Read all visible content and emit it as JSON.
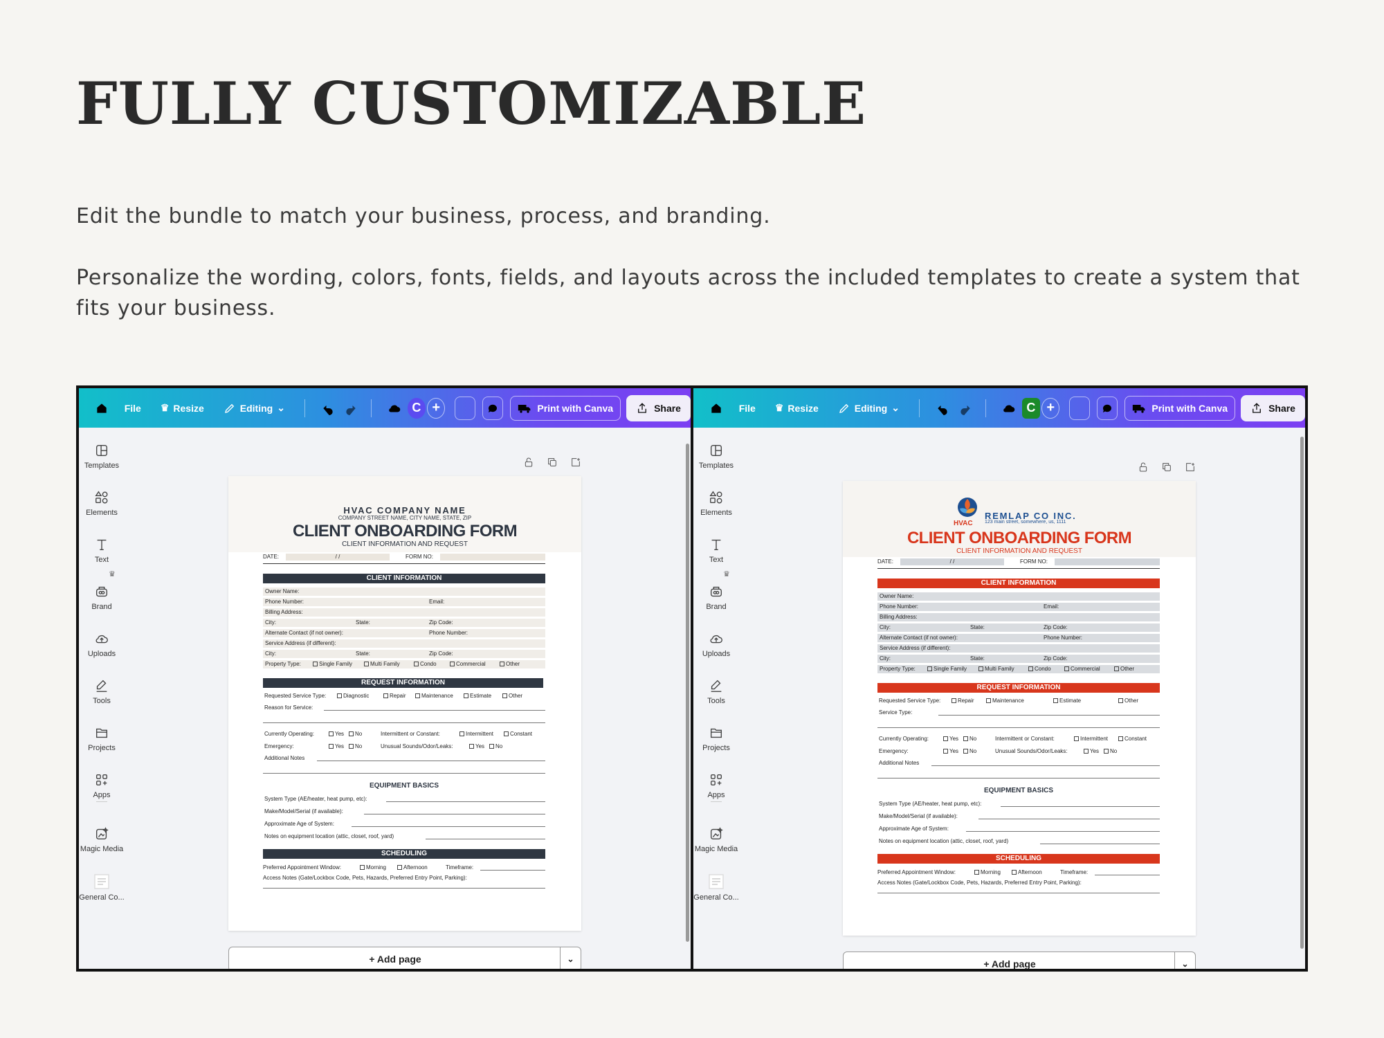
{
  "hero": {
    "title": "FULLY CUSTOMIZABLE",
    "line1": "Edit the bundle to match your business, process, and branding.",
    "line2": "Personalize the wording, colors, fonts, fields, and layouts across the included templates to create a system that fits your business."
  },
  "toolbar": {
    "file": "File",
    "resize": "Resize",
    "editing": "Editing",
    "print": "Print with Canva",
    "share": "Share",
    "avatar": "C",
    "avatar_color_left": "#5b4bf0",
    "avatar_color_right": "#1b8a2a"
  },
  "sidebar": {
    "templates": "Templates",
    "elements": "Elements",
    "text": "Text",
    "brand": "Brand",
    "uploads": "Uploads",
    "tools": "Tools",
    "projects": "Projects",
    "apps": "Apps",
    "magic_media": "Magic Media",
    "general": "General Co..."
  },
  "add_page": "+ Add page",
  "form": {
    "company_left": "HVAC COMPANY NAME",
    "address_left": "COMPANY STREET NAME, CITY NAME, STATE, ZIP",
    "logo_badge": "HVAC",
    "company_right": "REMLAP CO INC.",
    "address_right": "123 main street, somewhere, us, 1111",
    "title": "CLIENT ONBOARDING FORM",
    "subtitle": "CLIENT INFORMATION AND REQUEST",
    "date": "DATE:",
    "slashes": "/           /",
    "form_no": "FORM NO:",
    "client_info": "CLIENT INFORMATION",
    "owner": "Owner Name:",
    "phone": "Phone Number:",
    "email": "Email:",
    "billing": "Billing Address:",
    "city": "City:",
    "state": "State:",
    "zip": "Zip Code:",
    "alt_contact": "Alternate Contact (if not owner):",
    "alt_phone": "Phone Number:",
    "service_addr": "Service Address (if different):",
    "property_type": "Property Type:",
    "single_family": "Single Family",
    "multi_family": "Multi Family",
    "condo": "Condo",
    "commercial": "Commercial",
    "other": "Other",
    "request_info": "REQUEST INFORMATION",
    "req_service_type": "Requested Service Type:",
    "diagnostic": "Diagnostic",
    "repair": "Repair",
    "maintenance": "Maintenance",
    "estimate": "Estimate",
    "reason": "Reason for Service:",
    "service_type": "Service Type:",
    "currently_operating": "Currently Operating:",
    "yes": "Yes",
    "no": "No",
    "intermittent_q": "Intermittent or Constant:",
    "intermittent": "Intermittent",
    "constant": "Constant",
    "emergency": "Emergency:",
    "unusual": "Unusual Sounds/Odor/Leaks:",
    "additional_notes": "Additional Notes",
    "equipment_basics": "EQUIPMENT BASICS",
    "system_type": "System Type (AE/heater, heat pump, etc):",
    "make_model": "Make/Model/Serial (if available):",
    "approx_age": "Approximate Age of System:",
    "notes_location": "Notes on equipment location (attic, closet, roof, yard)",
    "scheduling": "SCHEDULING",
    "preferred_window": "Preferred Appointment Window:",
    "morning": "Morning",
    "afternoon": "Afternoon",
    "timeframe": "Timeframe:",
    "access_notes": "Access Notes (Gate/Lockbox Code, Pets, Hazards, Preferred Entry Point, Parking):"
  }
}
